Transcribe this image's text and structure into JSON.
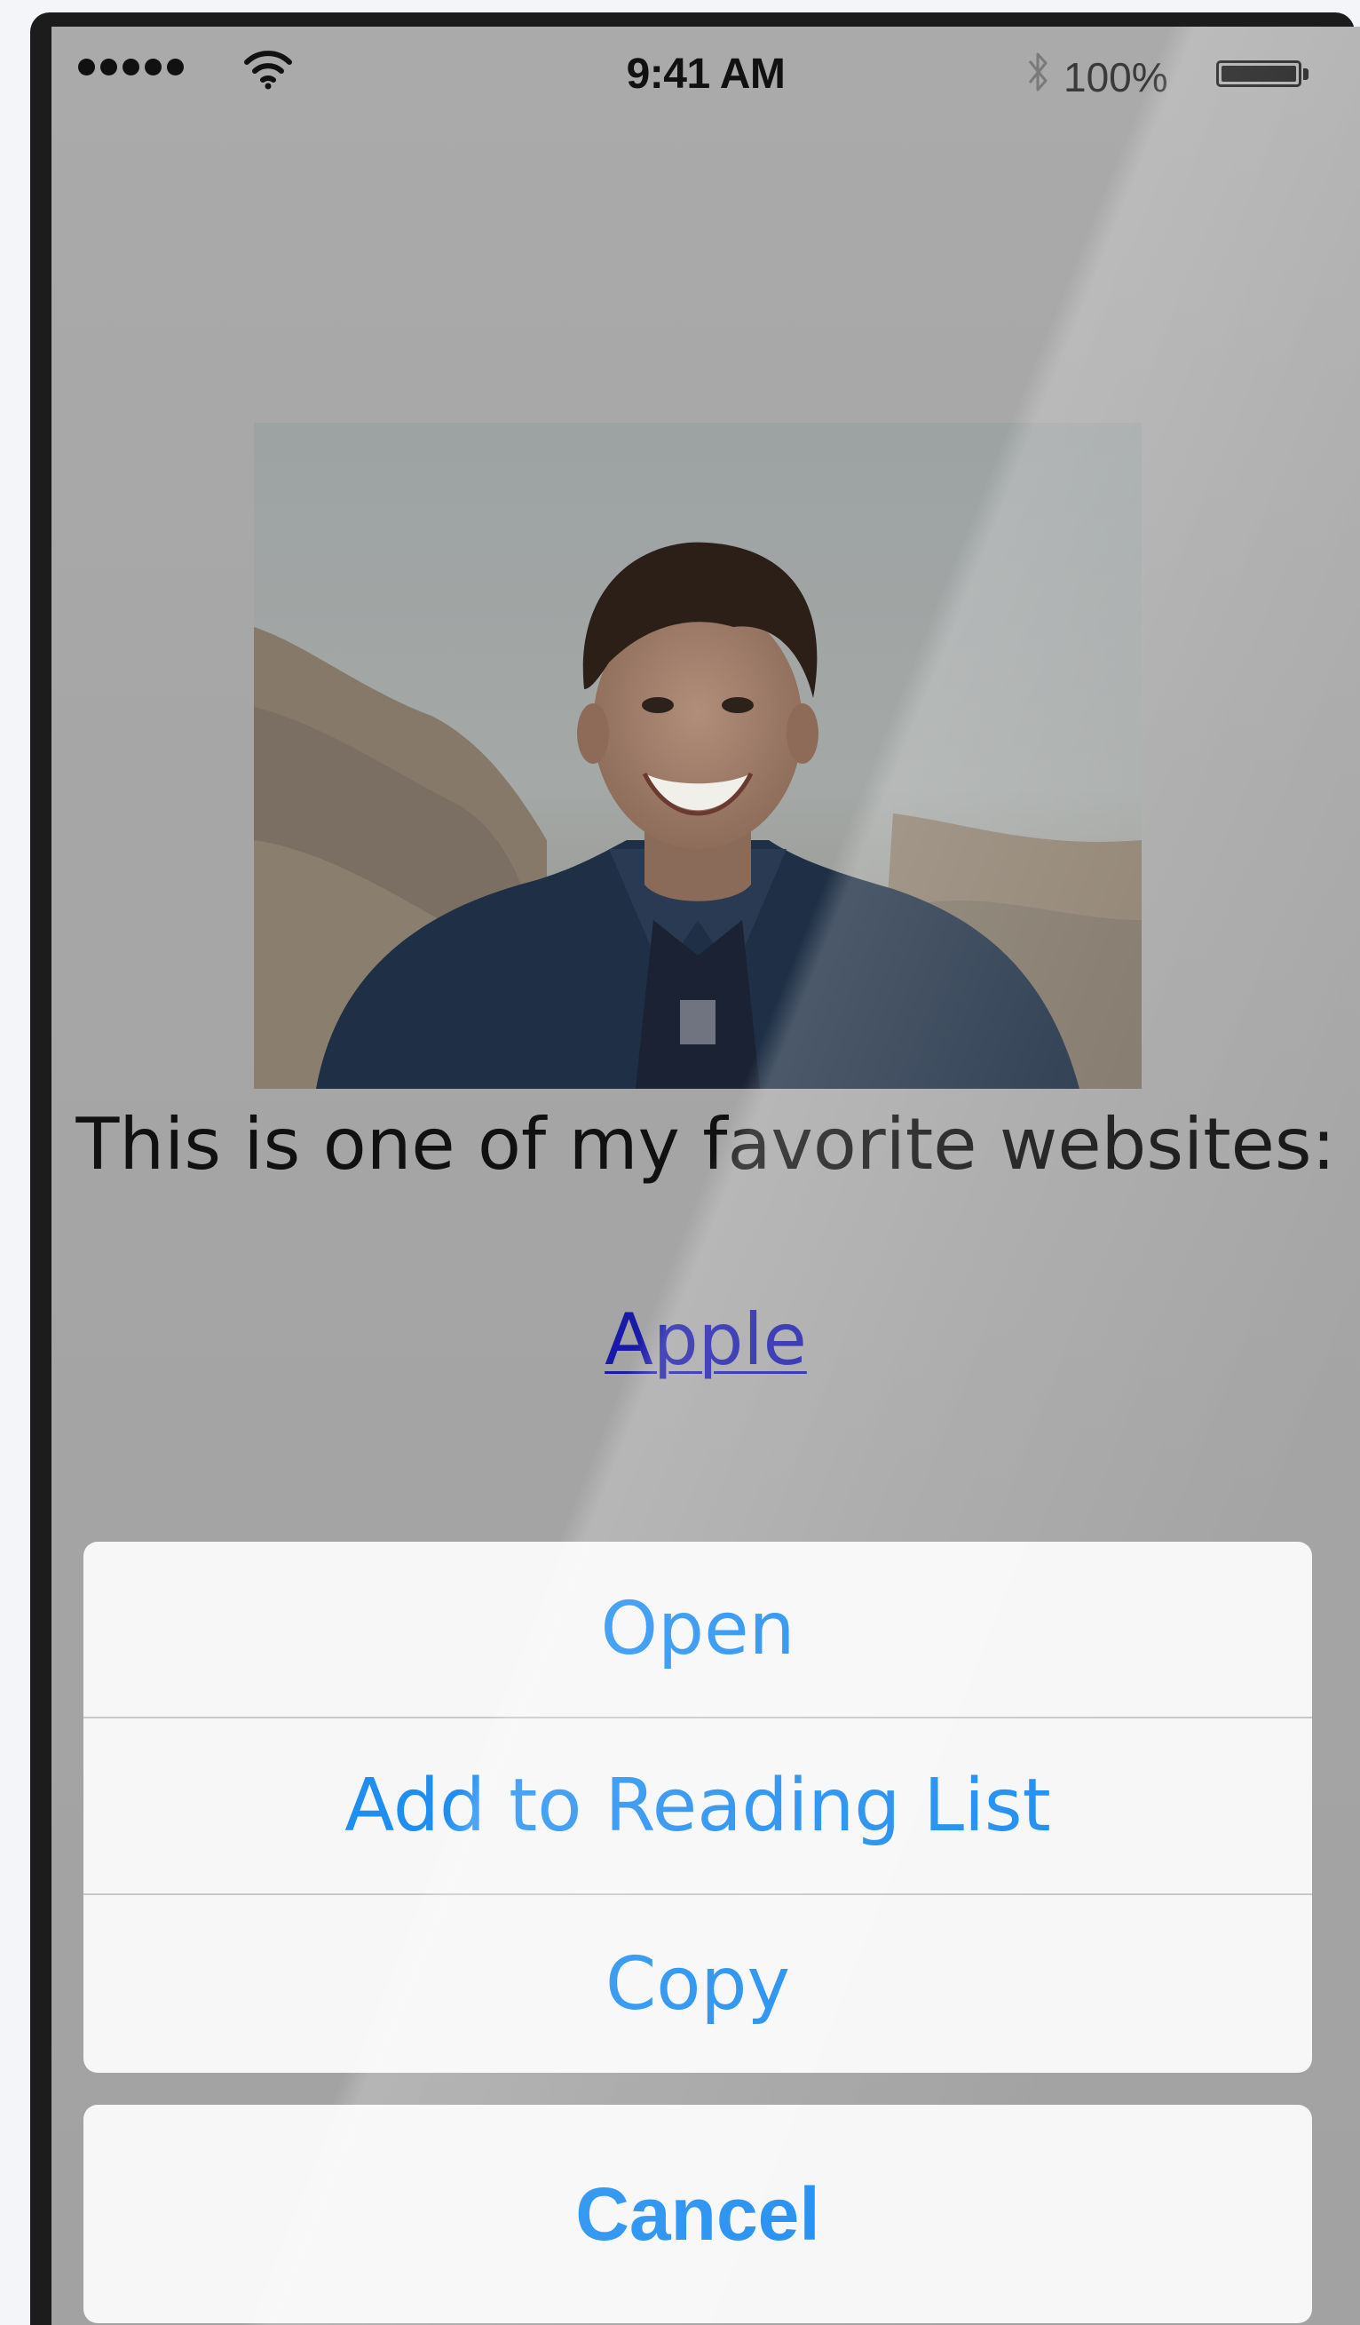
{
  "status_bar": {
    "time": "9:41 AM",
    "battery_percent": "100%",
    "signal_bars": 5,
    "wifi_icon": "wifi-icon",
    "bluetooth_icon": "bluetooth-icon",
    "battery_level": 1.0
  },
  "content": {
    "photo": "smiling-boy-photo",
    "caption": "This is one of my favorite websites:",
    "link_text": "Apple"
  },
  "action_sheet": {
    "items": [
      {
        "label": "Open"
      },
      {
        "label": "Add to Reading List"
      },
      {
        "label": "Copy"
      }
    ],
    "cancel_label": "Cancel"
  },
  "colors": {
    "action_blue": "#1f8ef1",
    "link_blue": "#1a1aa8",
    "dimmed_background": "#a6a6a6",
    "sheet_background": "#f7f7f7"
  }
}
